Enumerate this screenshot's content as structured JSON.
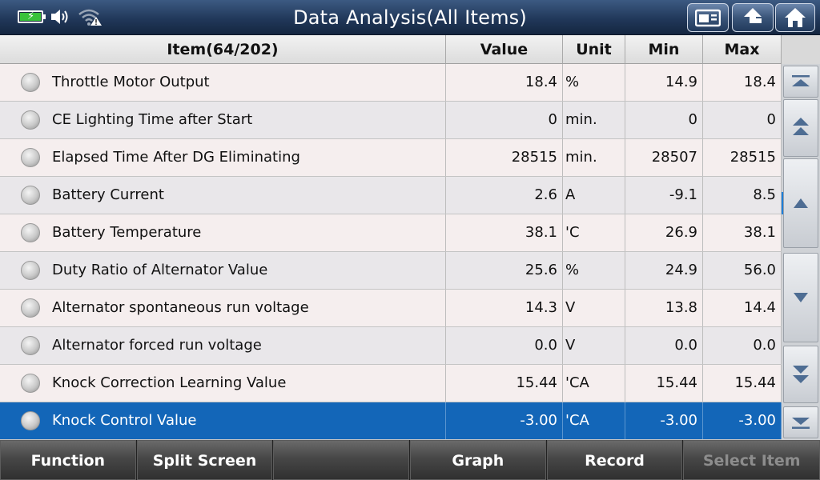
{
  "header": {
    "title": "Data Analysis(All Items)"
  },
  "table": {
    "columns": {
      "item": "Item(64/202)",
      "value": "Value",
      "unit": "Unit",
      "min": "Min",
      "max": "Max"
    },
    "rows": [
      {
        "item": "Throttle Motor Output",
        "value": "18.4",
        "unit": "%",
        "min": "14.9",
        "max": "18.4"
      },
      {
        "item": "CE Lighting Time after Start",
        "value": "0",
        "unit": "min.",
        "min": "0",
        "max": "0"
      },
      {
        "item": "Elapsed Time After DG Eliminating",
        "value": "28515",
        "unit": "min.",
        "min": "28507",
        "max": "28515"
      },
      {
        "item": "Battery Current",
        "value": "2.6",
        "unit": "A",
        "min": "-9.1",
        "max": "8.5"
      },
      {
        "item": "Battery Temperature",
        "value": "38.1",
        "unit": "'C",
        "min": "26.9",
        "max": "38.1"
      },
      {
        "item": "Duty Ratio of Alternator Value",
        "value": "25.6",
        "unit": "%",
        "min": "24.9",
        "max": "56.0"
      },
      {
        "item": "Alternator spontaneous run voltage",
        "value": "14.3",
        "unit": "V",
        "min": "13.8",
        "max": "14.4"
      },
      {
        "item": "Alternator forced run voltage",
        "value": "0.0",
        "unit": "V",
        "min": "0.0",
        "max": "0.0"
      },
      {
        "item": "Knock Correction Learning Value",
        "value": "15.44",
        "unit": "'CA",
        "min": "15.44",
        "max": "15.44"
      },
      {
        "item": "Knock Control Value",
        "value": "-3.00",
        "unit": "'CA",
        "min": "-3.00",
        "max": "-3.00"
      }
    ]
  },
  "toolbar": {
    "function": "Function",
    "split_screen": "Split Screen",
    "empty": "",
    "graph": "Graph",
    "record": "Record",
    "select_item": "Select Item"
  },
  "colors": {
    "selected_row": "#1366b8",
    "header_bar": "#21385a",
    "battery_fill": "#38c23a"
  }
}
